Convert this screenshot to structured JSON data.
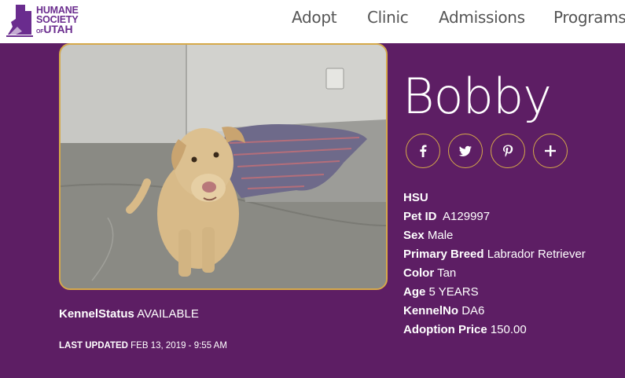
{
  "logo": {
    "line1": "HUMANE",
    "line2": "SOCIETY",
    "line3_of": "OF",
    "line3_utah": "UTAH",
    "icon": "utah-state-cat-icon"
  },
  "nav": {
    "items": [
      "Adopt",
      "Clinic",
      "Admissions",
      "Programs"
    ]
  },
  "pet": {
    "name": "Bobby",
    "shelter": "HSU",
    "fields": [
      {
        "label": "Pet ID",
        "value": "A129997"
      },
      {
        "label": "Sex",
        "value": "Male"
      },
      {
        "label": "Primary Breed",
        "value": "Labrador Retriever"
      },
      {
        "label": "Color",
        "value": "Tan"
      },
      {
        "label": "Age",
        "value": "5 YEARS"
      },
      {
        "label": "KennelNo",
        "value": "DA6"
      },
      {
        "label": "Adoption Price",
        "value": "150.00"
      }
    ],
    "photo_subject": "tan-labrador-dog-photo"
  },
  "kennel": {
    "status_label": "KennelStatus",
    "status_value": "AVAILABLE"
  },
  "updated": {
    "label": "LAST UPDATED",
    "value": "FEB 13, 2019 - 9:55 AM"
  },
  "share_buttons": [
    "facebook-icon",
    "twitter-icon",
    "pinterest-icon",
    "plus-icon"
  ],
  "colors": {
    "background": "#5d1e64",
    "accent_border": "#d6a94a",
    "header": "#ffffff",
    "nav_text": "#555555"
  }
}
